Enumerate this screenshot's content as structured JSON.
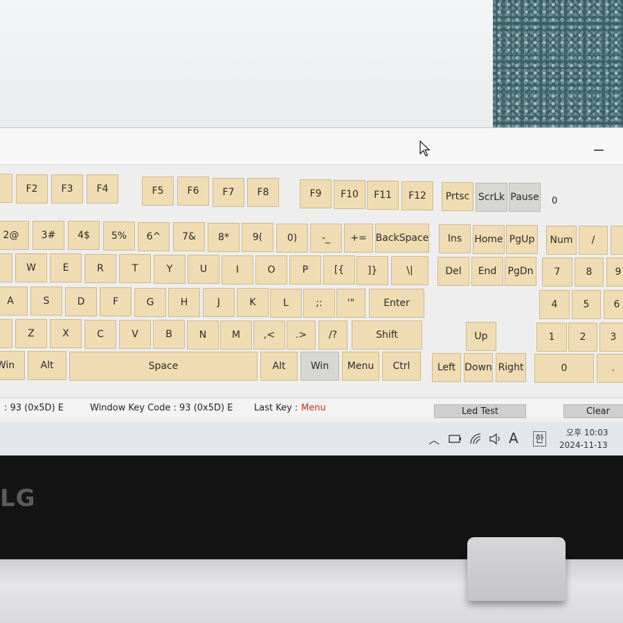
{
  "colors": {
    "key_face": "#efdcb2",
    "key_gray": "#d6d6d2",
    "last_key_value": "#d9261c",
    "window_bg": "#eeeeee"
  },
  "app": {
    "scroll_value": "0",
    "keys": {
      "row_f": [
        "F2",
        "F3",
        "F4",
        "F5",
        "F6",
        "F7",
        "F8",
        "F9",
        "F10",
        "F11",
        "F12",
        "Prtsc",
        "ScrLk",
        "Pause"
      ],
      "row_num": [
        "2@",
        "3#",
        "4$",
        "5%",
        "6^",
        "7&",
        "8*",
        "9(",
        "0)",
        "-_",
        "+=",
        "BackSpace",
        "Ins",
        "Home",
        "PgUp",
        "Num",
        "/"
      ],
      "row_q": [
        "W",
        "E",
        "R",
        "T",
        "Y",
        "U",
        "I",
        "O",
        "P",
        "[{",
        "]}",
        "\\|",
        "Del",
        "End",
        "PgDn",
        "7",
        "8",
        "9"
      ],
      "row_a": [
        "A",
        "S",
        "D",
        "F",
        "G",
        "H",
        "J",
        "K",
        "L",
        ";:",
        "'\"",
        "Enter",
        "4",
        "5",
        "6"
      ],
      "row_z": [
        "Z",
        "X",
        "C",
        "V",
        "B",
        "N",
        "M",
        ",<",
        ".>",
        "/?",
        "Shift",
        "Up",
        "1",
        "2",
        "3"
      ],
      "row_bottom": [
        "Win",
        "Alt",
        "Space",
        "Alt",
        "Win",
        "Menu",
        "Ctrl",
        "Left",
        "Down",
        "Right",
        "0",
        "."
      ]
    },
    "status": {
      "left_code": ": 93 (0x5D) E",
      "window_key_code": "Window Key Code : 93 (0x5D) E",
      "last_key_label": "Last Key :",
      "last_key_value": "Menu",
      "led_test_button": "Led Test",
      "clear_button": "Clear"
    }
  },
  "taskbar": {
    "ime_label": "A",
    "hangul_label": "한",
    "time": "오후 10:03",
    "date": "2024-11-13"
  },
  "laptop": {
    "logo": "LG"
  }
}
